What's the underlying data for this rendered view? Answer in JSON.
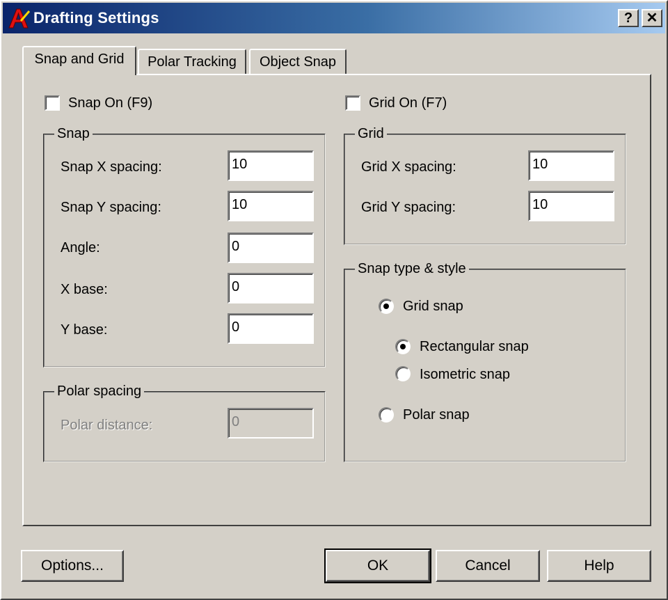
{
  "window": {
    "title": "Drafting Settings",
    "help_glyph": "?",
    "close_glyph": "✕",
    "icon": "autocad-icon"
  },
  "tabs": [
    {
      "label": "Snap and Grid",
      "active": true
    },
    {
      "label": "Polar Tracking",
      "active": false
    },
    {
      "label": "Object Snap",
      "active": false
    }
  ],
  "snap_on": {
    "label": "Snap On (F9)",
    "checked": false
  },
  "grid_on": {
    "label": "Grid On (F7)",
    "checked": false
  },
  "snap_group": {
    "title": "Snap",
    "x_spacing": {
      "label": "Snap X spacing:",
      "value": "10"
    },
    "y_spacing": {
      "label": "Snap Y spacing:",
      "value": "10"
    },
    "angle": {
      "label": "Angle:",
      "value": "0"
    },
    "x_base": {
      "label": "X base:",
      "value": "0"
    },
    "y_base": {
      "label": "Y base:",
      "value": "0"
    }
  },
  "grid_group": {
    "title": "Grid",
    "x_spacing": {
      "label": "Grid X spacing:",
      "value": "10"
    },
    "y_spacing": {
      "label": "Grid Y spacing:",
      "value": "10"
    }
  },
  "polar_group": {
    "title": "Polar spacing",
    "distance": {
      "label": "Polar distance:",
      "value": "0",
      "enabled": false
    }
  },
  "snap_type_group": {
    "title": "Snap type & style",
    "grid_snap": {
      "label": "Grid snap",
      "selected": true
    },
    "rectangular_snap": {
      "label": "Rectangular snap",
      "selected": true
    },
    "isometric_snap": {
      "label": "Isometric snap",
      "selected": false
    },
    "polar_snap": {
      "label": "Polar snap",
      "selected": false
    }
  },
  "buttons": {
    "options": "Options...",
    "ok": "OK",
    "cancel": "Cancel",
    "help": "Help"
  }
}
